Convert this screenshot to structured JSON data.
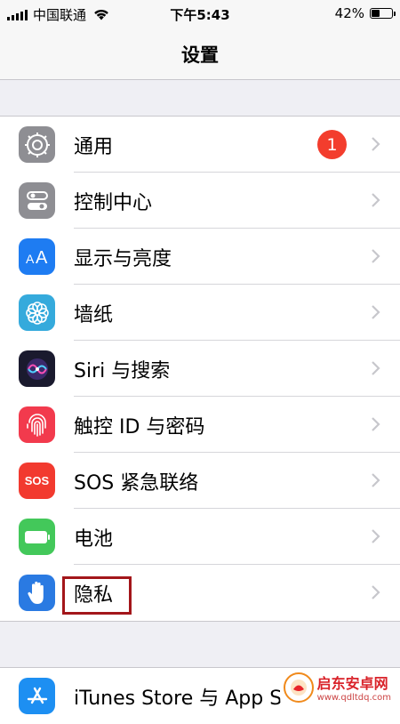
{
  "status_bar": {
    "carrier": "中国联通",
    "time": "下午5:43",
    "battery_percent": "42%",
    "battery_level": 0.42
  },
  "header": {
    "title": "设置"
  },
  "settings": {
    "group1": [
      {
        "label": "通用",
        "icon": "gear-icon",
        "color": "#8e8e93",
        "badge": "1"
      },
      {
        "label": "控制中心",
        "icon": "toggles-icon",
        "color": "#8e8e93"
      },
      {
        "label": "显示与亮度",
        "icon": "text-size-icon",
        "color": "#1e7cf2"
      },
      {
        "label": "墙纸",
        "icon": "flower-icon",
        "color": "#35aadc"
      },
      {
        "label": "Siri 与搜索",
        "icon": "siri-icon",
        "color": "#1a1a2e"
      },
      {
        "label": "触控 ID 与密码",
        "icon": "fingerprint-icon",
        "color": "#f23a4d"
      },
      {
        "label": "SOS 紧急联络",
        "icon": "sos-icon",
        "color": "#f23a2f",
        "icon_text": "SOS"
      },
      {
        "label": "电池",
        "icon": "battery-icon",
        "color": "#43c85a"
      },
      {
        "label": "隐私",
        "icon": "hand-icon",
        "color": "#2a7ae2"
      }
    ],
    "group2": [
      {
        "label": "iTunes Store 与 App S",
        "icon": "app-store-icon",
        "color": "#1d8ff2"
      }
    ]
  },
  "watermark": {
    "name": "启东安卓网",
    "url": "www.qdltdq.com"
  }
}
